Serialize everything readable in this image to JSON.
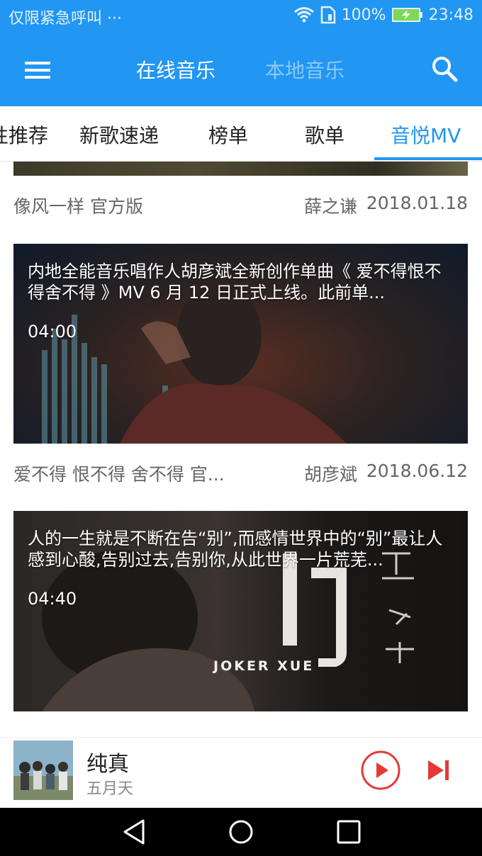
{
  "status_bar": {
    "carrier": "仅限紧急呼叫 ···",
    "battery_percent": "100%",
    "time": "23:48",
    "icons": [
      "wifi-icon",
      "sim-icon",
      "battery-charging-icon"
    ]
  },
  "app_bar": {
    "tabs": [
      {
        "label": "在线音乐",
        "active": true
      },
      {
        "label": "本地音乐",
        "active": false
      }
    ],
    "menu_icon": "hamburger-menu-icon",
    "search_icon": "search-icon"
  },
  "category_tabs": [
    {
      "label": "个性推荐",
      "active": false
    },
    {
      "label": "新歌速递",
      "active": false
    },
    {
      "label": "榜单",
      "active": false
    },
    {
      "label": "歌单",
      "active": false
    },
    {
      "label": "音悦MV",
      "active": true
    }
  ],
  "videos": [
    {
      "title": "像风一样 官方版",
      "artist": "薛之谦",
      "date": "2018.01.18"
    },
    {
      "description": "内地全能音乐唱作人胡彦斌全新创作单曲《 爱不得恨不得舍不得 》MV 6 月 12 日正式上线。此前单...",
      "duration": "04:00",
      "title": "爱不得 恨不得 舍不得 官...",
      "artist": "胡彦斌",
      "date": "2018.06.12"
    },
    {
      "description": "人的一生就是不断在告“别”,而感情世界中的“别”最让人感到心酸,告别过去,告别你,从此世界一片荒芜...",
      "duration": "04:40",
      "poster_text": "JOKER XUE"
    }
  ],
  "player": {
    "song": "纯真",
    "artist": "五月天",
    "accent": "#e53935"
  },
  "colors": {
    "primary": "#2196f3",
    "accent": "#e53935"
  }
}
